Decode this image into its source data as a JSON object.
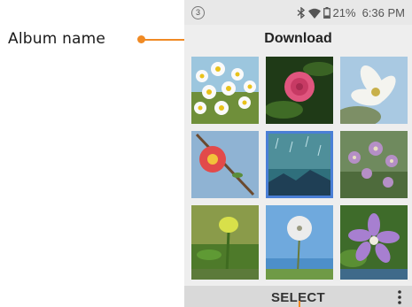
{
  "callout": {
    "label": "Album name"
  },
  "status_bar": {
    "notification_badge": "3",
    "battery": "21%",
    "time": "6:36 PM",
    "icons": [
      "bluetooth-icon",
      "wifi-icon",
      "battery-icon"
    ]
  },
  "header": {
    "title": "Download"
  },
  "gallery": {
    "thumbnails": [
      {
        "subject": "daisies"
      },
      {
        "subject": "pink-rose"
      },
      {
        "subject": "white-flower"
      },
      {
        "subject": "red-flower-branch"
      },
      {
        "subject": "rain-landscape"
      },
      {
        "subject": "purple-flowers"
      },
      {
        "subject": "green-flower-bud"
      },
      {
        "subject": "dandelion"
      },
      {
        "subject": "purple-star-flower"
      }
    ]
  },
  "bottom_bar": {
    "select_label": "SELECT"
  },
  "colors": {
    "accent": "#f08a24",
    "selected_border": "#4a7fd6"
  }
}
